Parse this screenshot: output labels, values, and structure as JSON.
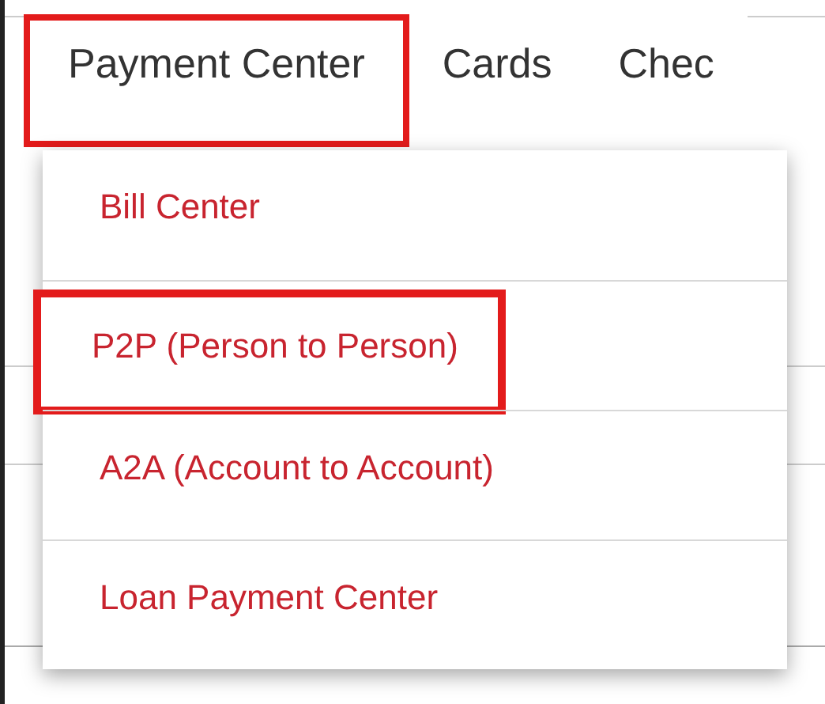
{
  "nav": [
    {
      "label": "Payment Center",
      "highlighted": true
    },
    {
      "label": "Cards",
      "highlighted": false
    },
    {
      "label": "Chec",
      "highlighted": false
    }
  ],
  "menu": [
    {
      "label": "Bill Center",
      "highlighted": false
    },
    {
      "label": "P2P (Person to Person)",
      "highlighted": true
    },
    {
      "label": "A2A (Account to Account)",
      "highlighted": false
    },
    {
      "label": "Loan Payment Center",
      "highlighted": false
    }
  ]
}
